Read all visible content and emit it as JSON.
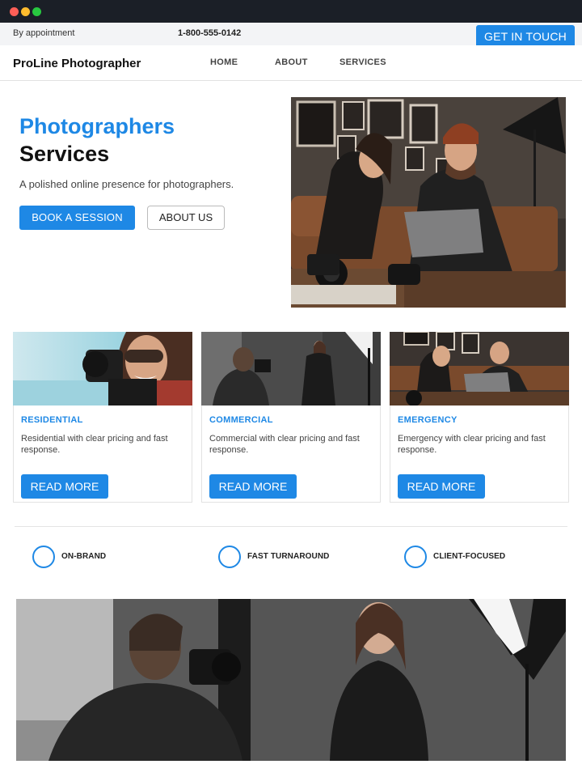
{
  "topbar": {
    "hours": "By appointment",
    "phone": "1-800-555-0142",
    "cta_label": "GET IN TOUCH"
  },
  "nav": {
    "brand": "ProLine Photographer",
    "links": [
      "HOME",
      "ABOUT",
      "SERVICES"
    ]
  },
  "hero": {
    "title_accent": "Photographers",
    "title_rest": "Services",
    "subtitle": "A polished online presence for photographers.",
    "primary_button": "BOOK A SESSION",
    "secondary_button": "ABOUT US",
    "image": "photo-couple-laptop"
  },
  "cards": [
    {
      "title": "RESIDENTIAL",
      "text": "Residential with clear pricing and fast response.",
      "button": "READ MORE",
      "image": "photo-woman-camera"
    },
    {
      "title": "COMMERCIAL",
      "text": "Commercial with clear pricing and fast response.",
      "button": "READ MORE",
      "image": "photo-studio-shoot"
    },
    {
      "title": "EMERGENCY",
      "text": "Emergency with clear pricing and fast response.",
      "button": "READ MORE",
      "image": "photo-couple-laptop"
    }
  ],
  "features": [
    "ON-BRAND",
    "FAST TURNAROUND",
    "CLIENT-FOCUSED"
  ],
  "banner": {
    "image": "photo-studio-shoot"
  },
  "colors": {
    "accent": "#1e88e5",
    "chrome": "#1b1f27",
    "topbar_bg": "#f3f4f6"
  }
}
